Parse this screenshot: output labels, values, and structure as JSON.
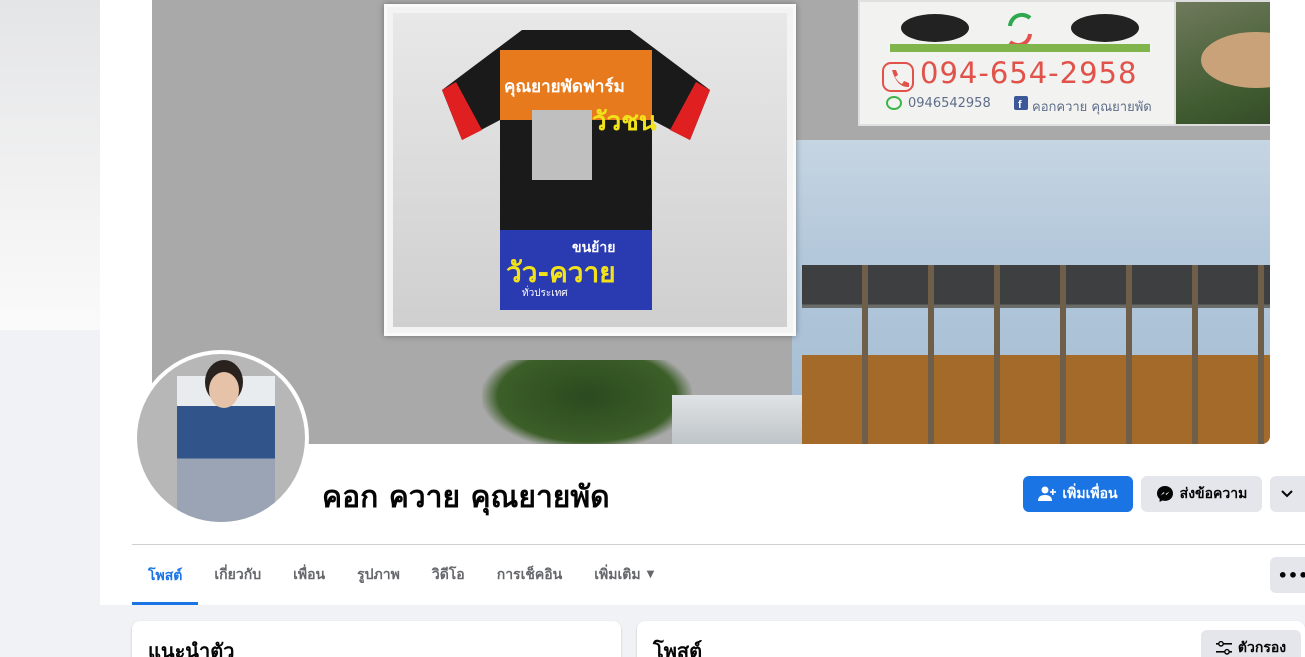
{
  "cover": {
    "phone": "094-654-2958",
    "line_id": "0946542958",
    "facebook_name": "คอกควาย คุณยายพัด",
    "shirt_title": "คุณยายพัดฟาร์ม",
    "shirt_sub": "วัวชน",
    "shirt_bottom_small": "ขนย้าย",
    "shirt_bottom": "วัว-ควาย",
    "shirt_bottom_note": "ทั่วประเทศ"
  },
  "profile": {
    "name": "คอก ควาย คุณยายพัด"
  },
  "actions": {
    "add_friend": "เพิ่มเพื่อน",
    "message": "ส่งข้อความ"
  },
  "tabs": [
    {
      "label": "โพสต์",
      "active": true
    },
    {
      "label": "เกี่ยวกับ",
      "active": false
    },
    {
      "label": "เพื่อน",
      "active": false
    },
    {
      "label": "รูปภาพ",
      "active": false
    },
    {
      "label": "วิดีโอ",
      "active": false
    },
    {
      "label": "การเช็คอิน",
      "active": false
    },
    {
      "label": "เพิ่มเติม",
      "active": false
    }
  ],
  "more_dots": "•••",
  "intro": {
    "title": "แนะนำตัว"
  },
  "posts": {
    "title": "โพสต์",
    "filter_label": "ตัวกรอง"
  },
  "colors": {
    "accent": "#1b74e4",
    "phone": "#e0524a"
  }
}
